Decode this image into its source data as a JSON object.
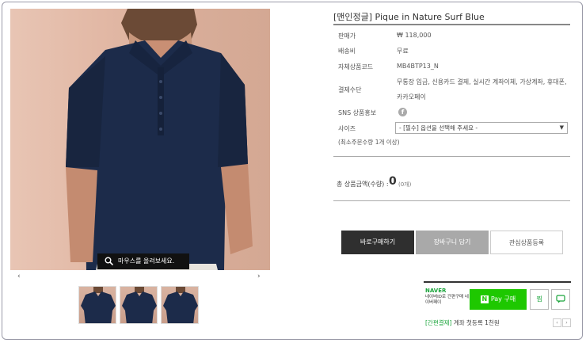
{
  "product": {
    "title": "[맨인정글] Pique in Nature Surf Blue",
    "zoom_hint": "마우스를 올려보세요.",
    "prev_arrow": "‹",
    "next_arrow": "›"
  },
  "details": {
    "price_label": "판매가",
    "price_value": "₩ 118,000",
    "shipping_label": "배송비",
    "shipping_value": "무료",
    "code_label": "자체상품코드",
    "code_value": "MB4BTP13_N",
    "payment_label": "결제수단",
    "payment_line1": "무통장 입금, 신용카드 결제, 실시간 계좌이체, 가상계좌, 휴대폰,",
    "payment_line2": "카카오페이",
    "sns_label": "SNS 상품홍보",
    "size_label": "사이즈",
    "size_placeholder": "- [필수] 옵션을 선택해 주세요 -",
    "min_order": "(최소주문수량 1개 이상)"
  },
  "total": {
    "label": "총 상품금액(수량) :",
    "amount": "0",
    "count": "(0개)"
  },
  "buttons": {
    "buy": "바로구매하기",
    "cart": "장바구니 담기",
    "wish": "관심상품등록"
  },
  "naver_pay": {
    "logo": "NAVER",
    "desc": "네이버ID로 간편구매 네이버페이",
    "pay_label": "Pay 구매",
    "wish_label": "찜",
    "talk_label": "talk",
    "footer_tag": "[간편결제]",
    "footer_text": " 계좌 첫등록 1천원"
  },
  "colors": {
    "shirt": "#1c2b4a",
    "background": "#e2b8a5",
    "naver_green": "#1ec800"
  }
}
